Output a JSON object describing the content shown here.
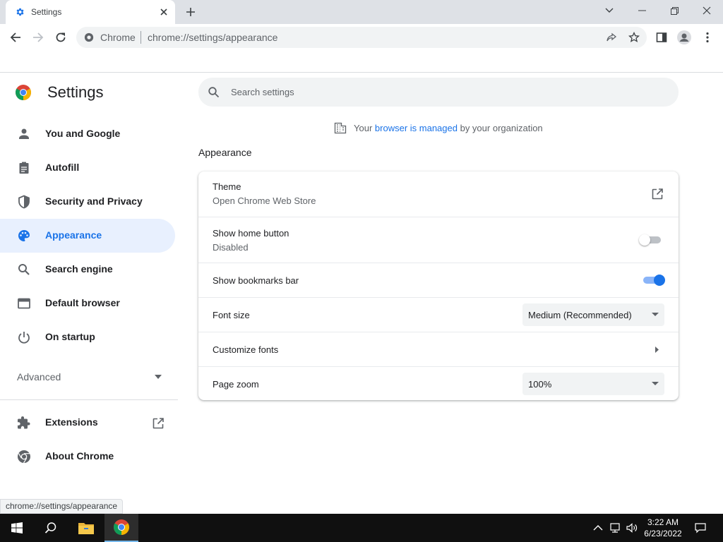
{
  "tab": {
    "title": "Settings"
  },
  "omnibox": {
    "site": "Chrome",
    "url_prefix": "chrome://",
    "url_path": "settings/appearance"
  },
  "sidebar": {
    "title": "Settings",
    "items": [
      {
        "label": "You and Google",
        "icon": "person-icon"
      },
      {
        "label": "Autofill",
        "icon": "clipboard-icon"
      },
      {
        "label": "Security and Privacy",
        "icon": "shield-icon"
      },
      {
        "label": "Appearance",
        "icon": "palette-icon",
        "active": true
      },
      {
        "label": "Search engine",
        "icon": "search-icon"
      },
      {
        "label": "Default browser",
        "icon": "browser-window-icon"
      },
      {
        "label": "On startup",
        "icon": "power-icon"
      }
    ],
    "advanced": "Advanced",
    "extensions": "Extensions",
    "about": "About Chrome"
  },
  "search": {
    "placeholder": "Search settings"
  },
  "managed": {
    "pre": "Your",
    "link": "browser is managed",
    "post": "by your organization"
  },
  "appearance": {
    "section_title": "Appearance",
    "theme": {
      "title": "Theme",
      "subtitle": "Open Chrome Web Store"
    },
    "home_button": {
      "title": "Show home button",
      "subtitle": "Disabled",
      "enabled": false
    },
    "bookmarks_bar": {
      "title": "Show bookmarks bar",
      "enabled": true
    },
    "font_size": {
      "title": "Font size",
      "value": "Medium (Recommended)"
    },
    "customize_fonts": {
      "title": "Customize fonts"
    },
    "page_zoom": {
      "title": "Page zoom",
      "value": "100%"
    }
  },
  "status_bubble": "chrome://settings/appearance",
  "taskbar": {
    "time": "3:22 AM",
    "date": "6/23/2022"
  },
  "colors": {
    "accent": "#1a73e8",
    "active_nav_bg": "#e8f0fe",
    "taskbar": "#101010"
  }
}
